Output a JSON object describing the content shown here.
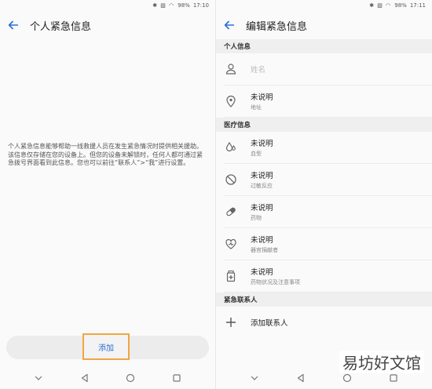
{
  "status": {
    "icons": "✱ ▧ ◠",
    "battery": "98%",
    "time": "17:10",
    "time_right": "17:11"
  },
  "left": {
    "title": "个人紧急信息",
    "description": "个人紧急信息能够帮助一线救援人员在发生紧急情况时提供相关援助。该信息仅存储在您的设备上。但您的设备未解锁时，任何人都可通过紧急拨号界面看到此信息。您也可以前往“联系人”>“我”进行设置。",
    "add_label": "添加"
  },
  "right": {
    "title": "编辑紧急信息",
    "sections": {
      "personal": "个人信息",
      "medical": "医疗信息",
      "contacts": "紧急联系人"
    },
    "name_placeholder": "姓名",
    "address": {
      "value": "未说明",
      "label": "地址"
    },
    "blood": {
      "value": "未说明",
      "label": "血型"
    },
    "allergy": {
      "value": "未说明",
      "label": "过敏反应"
    },
    "medicine": {
      "value": "未说明",
      "label": "药物"
    },
    "donor": {
      "value": "未说明",
      "label": "器官捐献者"
    },
    "condition": {
      "value": "未说明",
      "label": "药物状况及注意事项"
    },
    "add_contact": "添加联系人"
  },
  "watermark": "易坊好文馆",
  "colors": {
    "accent": "#2a6fd6",
    "highlight": "#f0a640"
  }
}
